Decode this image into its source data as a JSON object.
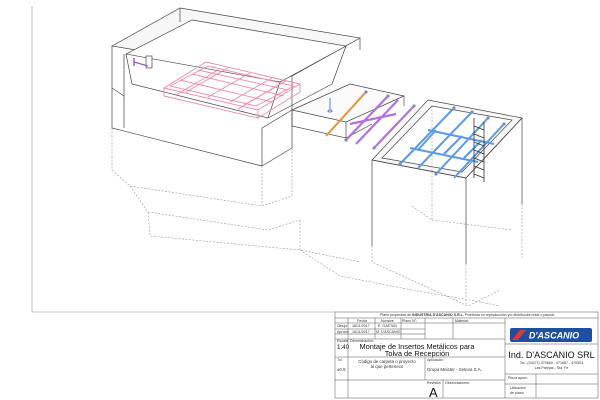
{
  "drawing": {
    "description_icons": [
      "hopper-upper-box",
      "pink-steel-grid",
      "purple-beams",
      "blue-frame",
      "ladder"
    ],
    "colors": {
      "hopper_grid": "#f08aa8",
      "purple_beams": "#b26fe0",
      "blue_frame": "#5b9ae6",
      "orange_beam": "#e8923a",
      "outline": "#444444",
      "hidden": "#9a9a9a"
    }
  },
  "title_block": {
    "ownership_prefix": "Plano propiedad de",
    "ownership_company": "INDUSTRIA D'ASCANIO S.R.L.",
    "ownership_suffix": "Prohibida su reproducción y/o distribución total o parcial.",
    "col_fecha": "Fecha",
    "col_nombre": "Nombre",
    "col_plano": "Plano N°:",
    "col_material": "Material:",
    "dibujo_label": "Dibujó",
    "dibujo_fecha": "16/11/2017",
    "dibujo_nombre": "E. GAETAN",
    "aprobo_label": "Aprobó",
    "aprobo_fecha": "16/11/2017",
    "aprobo_nombre": "M. D'ASCANIO",
    "escala_label": "Escala",
    "escala_value": "1:40",
    "denominacion_label": "Denominación:",
    "denominacion_line1": "Montaje de Insertos Metálicos para",
    "denominacion_line2": "Tolva de Recepción",
    "tol_label": "Tol",
    "tol_value": "±0.5",
    "codigo_line1": "Código de carpeta o proyecto",
    "codigo_line2": "al que pertenece",
    "aplicacion_label": "Aplicación",
    "aplicacion_value": "Grupo Meister - Seteva S.A.",
    "revision_label": "Revisión",
    "revision_value": "A",
    "observaciones_label": "Observaciones:",
    "logo_text": "D'ASCANIO",
    "company_name": "Ind. D'ASCANIO SRL",
    "company_phone": "Tel.: (03471) 470660 - 471857 - 470503",
    "company_city": "Las Parejas - Sta. Fe",
    "pieza_label": "Pieza aprox.",
    "ubicacion_label1": "Ubicación",
    "ubicacion_label2": "de plano"
  }
}
